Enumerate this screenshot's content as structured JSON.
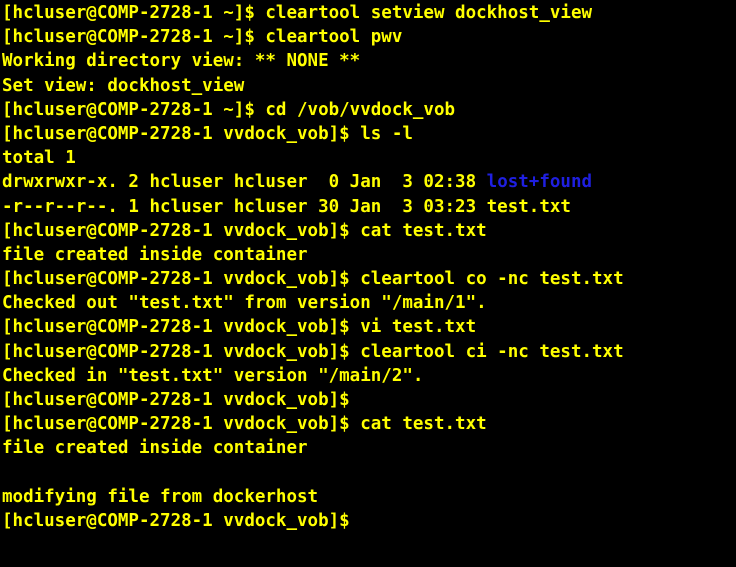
{
  "terminal": {
    "window_title": "Terminal",
    "background_color": "#000000",
    "foreground_color": "#ffff00",
    "directory_color": "#1f1fe0",
    "columns": 61,
    "rows": 23,
    "prompt_home": "[hcluser@COMP-2728-1 ~]$",
    "prompt_vob": "[hcluser@COMP-2728-1 vvdock_vob]$",
    "user": "hcluser",
    "host": "COMP-2728-1",
    "lines": [
      {
        "id": "line-1",
        "segments": [
          {
            "text": "[hcluser@COMP-2728-1 ~]$ cleartool setview dockhost_view",
            "color": "yellow"
          }
        ]
      },
      {
        "id": "line-2",
        "segments": [
          {
            "text": "[hcluser@COMP-2728-1 ~]$ cleartool pwv",
            "color": "yellow"
          }
        ]
      },
      {
        "id": "line-3",
        "segments": [
          {
            "text": "Working directory view: ** NONE **",
            "color": "yellow"
          }
        ]
      },
      {
        "id": "line-4",
        "segments": [
          {
            "text": "Set view: dockhost_view",
            "color": "yellow"
          }
        ]
      },
      {
        "id": "line-5",
        "segments": [
          {
            "text": "[hcluser@COMP-2728-1 ~]$ cd /vob/vvdock_vob",
            "color": "yellow"
          }
        ]
      },
      {
        "id": "line-6",
        "segments": [
          {
            "text": "[hcluser@COMP-2728-1 vvdock_vob]$ ls -l",
            "color": "yellow"
          }
        ]
      },
      {
        "id": "line-7",
        "segments": [
          {
            "text": "total 1",
            "color": "yellow"
          }
        ]
      },
      {
        "id": "line-8",
        "segments": [
          {
            "text": "drwxrwxr-x. 2 hcluser hcluser  0 Jan  3 02:38 ",
            "color": "yellow"
          },
          {
            "text": "lost+found",
            "color": "blue"
          }
        ]
      },
      {
        "id": "line-9",
        "segments": [
          {
            "text": "-r--r--r--. 1 hcluser hcluser 30 Jan  3 03:23 test.txt",
            "color": "yellow"
          }
        ]
      },
      {
        "id": "line-10",
        "segments": [
          {
            "text": "[hcluser@COMP-2728-1 vvdock_vob]$ cat test.txt",
            "color": "yellow"
          }
        ]
      },
      {
        "id": "line-11",
        "segments": [
          {
            "text": "file created inside container",
            "color": "yellow"
          }
        ]
      },
      {
        "id": "line-12",
        "segments": [
          {
            "text": "[hcluser@COMP-2728-1 vvdock_vob]$ cleartool co -nc test.txt",
            "color": "yellow"
          }
        ]
      },
      {
        "id": "line-13",
        "segments": [
          {
            "text": "Checked out \"test.txt\" from version \"/main/1\".",
            "color": "yellow"
          }
        ]
      },
      {
        "id": "line-14",
        "segments": [
          {
            "text": "[hcluser@COMP-2728-1 vvdock_vob]$ vi test.txt",
            "color": "yellow"
          }
        ]
      },
      {
        "id": "line-15",
        "segments": [
          {
            "text": "[hcluser@COMP-2728-1 vvdock_vob]$ cleartool ci -nc test.txt",
            "color": "yellow"
          }
        ]
      },
      {
        "id": "line-16",
        "segments": [
          {
            "text": "Checked in \"test.txt\" version \"/main/2\".",
            "color": "yellow"
          }
        ]
      },
      {
        "id": "line-17",
        "segments": [
          {
            "text": "[hcluser@COMP-2728-1 vvdock_vob]$",
            "color": "yellow"
          }
        ]
      },
      {
        "id": "line-18",
        "segments": [
          {
            "text": "[hcluser@COMP-2728-1 vvdock_vob]$ cat test.txt",
            "color": "yellow"
          }
        ]
      },
      {
        "id": "line-19",
        "segments": [
          {
            "text": "file created inside container",
            "color": "yellow"
          }
        ]
      },
      {
        "id": "line-20",
        "segments": [
          {
            "text": "",
            "color": "yellow"
          }
        ]
      },
      {
        "id": "line-21",
        "segments": [
          {
            "text": "modifying file from dockerhost",
            "color": "yellow"
          }
        ]
      },
      {
        "id": "line-22",
        "segments": [
          {
            "text": "[hcluser@COMP-2728-1 vvdock_vob]$",
            "color": "yellow"
          }
        ]
      },
      {
        "id": "line-23",
        "segments": [
          {
            "text": "",
            "color": "yellow"
          }
        ]
      }
    ]
  }
}
